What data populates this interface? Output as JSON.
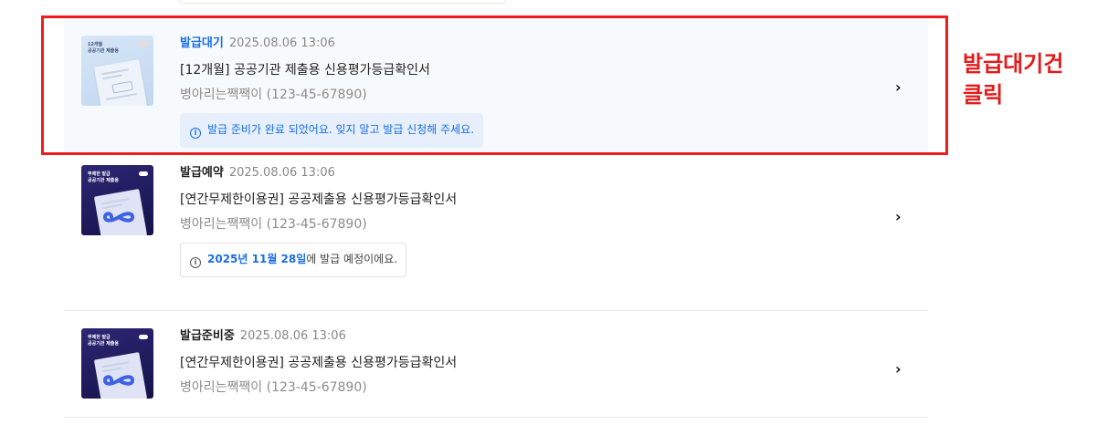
{
  "items": [
    {
      "status": "발급대기",
      "date": "2025.08.06 13:06",
      "title": "[12개월] 공공기관 제출용 신용평가등급확인서",
      "company": "병아리는짹짹이 (123-45-67890)",
      "thumbnail_label": "12개월\n공공기관 제출용",
      "thumbnail_style": "light",
      "notice": "발급 준비가 완료 되었어요. 잊지 말고 발급 신청해 주세요.",
      "notice_icon": "info-icon",
      "chevron_icon": "chevron-right-icon"
    },
    {
      "status": "발급예약",
      "date": "2025.08.06 13:06",
      "title": "[연간무제한이용권] 공공제출용 신용평가등급확인서",
      "company": "병아리는짹짹이 (123-45-67890)",
      "thumbnail_label": "무제한 발급\n공공기관 제출용",
      "thumbnail_style": "dark",
      "notice_highlight": "2025년 11월 28일",
      "notice_suffix": "에 발급 예정이에요.",
      "notice_icon": "info-icon",
      "chevron_icon": "chevron-right-icon"
    },
    {
      "status": "발급준비중",
      "date": "2025.08.06 13:06",
      "title": "[연간무제한이용권] 공공제출용 신용평가등급확인서",
      "company": "병아리는짹짹이 (123-45-67890)",
      "thumbnail_label": "무제한 발급\n공공기관 제출용",
      "thumbnail_style": "dark",
      "chevron_icon": "chevron-right-icon"
    }
  ],
  "annotation": {
    "text": "발급대기건\n클릭",
    "color": "#e31b1b"
  },
  "colors": {
    "status_blue": "#1a6ee6",
    "notice_bg": "#e6effb",
    "highlight_border": "#ee1c1c"
  }
}
